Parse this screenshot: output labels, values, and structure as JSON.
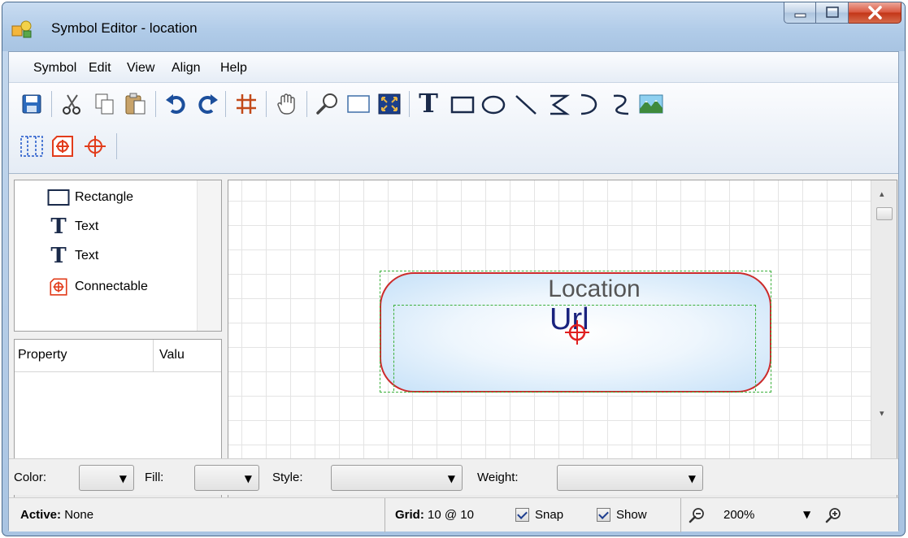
{
  "window": {
    "title": "Symbol Editor - location",
    "icons": {
      "app": "app-icon",
      "minimize": "minimize-icon",
      "maximize": "maximize-icon",
      "close": "close-icon"
    }
  },
  "menu": {
    "items": [
      {
        "label": "Symbol"
      },
      {
        "label": "Edit"
      },
      {
        "label": "View"
      },
      {
        "label": "Align"
      },
      {
        "label": "Help"
      }
    ]
  },
  "toolbar": {
    "row1": [
      "save-icon",
      "cut-icon",
      "copy-icon",
      "paste-icon",
      "undo-icon",
      "redo-icon",
      "grid-icon",
      "pan-hand-icon",
      "zoom-icon",
      "zoom-rect-icon",
      "fit-icon",
      "text-tool-icon",
      "rectangle-tool-icon",
      "ellipse-tool-icon",
      "line-tool-icon",
      "polyline-tool-icon",
      "arc-tool-icon",
      "curve-tool-icon",
      "image-tool-icon"
    ],
    "row2": [
      "frame-icon",
      "connectable-icon",
      "anchor-icon"
    ],
    "text_glyph": "T"
  },
  "tree": {
    "items": [
      {
        "label": "Rectangle",
        "icon": "rectangle-icon"
      },
      {
        "label": "Text",
        "icon": "text-icon"
      },
      {
        "label": "Text",
        "icon": "text-icon"
      },
      {
        "label": "Connectable",
        "icon": "connectable-icon"
      }
    ],
    "text_glyph": "T"
  },
  "properties": {
    "columns": [
      "Property",
      "Valu"
    ]
  },
  "canvas": {
    "symbol_title": "Location",
    "symbol_url": "Url",
    "colors": {
      "border": "#cc2b2b",
      "fill": "#c6e1f8",
      "selection": "#3cb03c",
      "url_text": "#1a237e"
    }
  },
  "property_bar": {
    "color_label": "Color:",
    "fill_label": "Fill:",
    "style_label": "Style:",
    "weight_label": "Weight:"
  },
  "status": {
    "active_label": "Active:",
    "active_value": "None",
    "grid_label": "Grid:",
    "grid_value": "10 @ 10",
    "snap_label": "Snap",
    "show_label": "Show",
    "snap_checked": true,
    "show_checked": true,
    "zoom_value": "200%"
  }
}
